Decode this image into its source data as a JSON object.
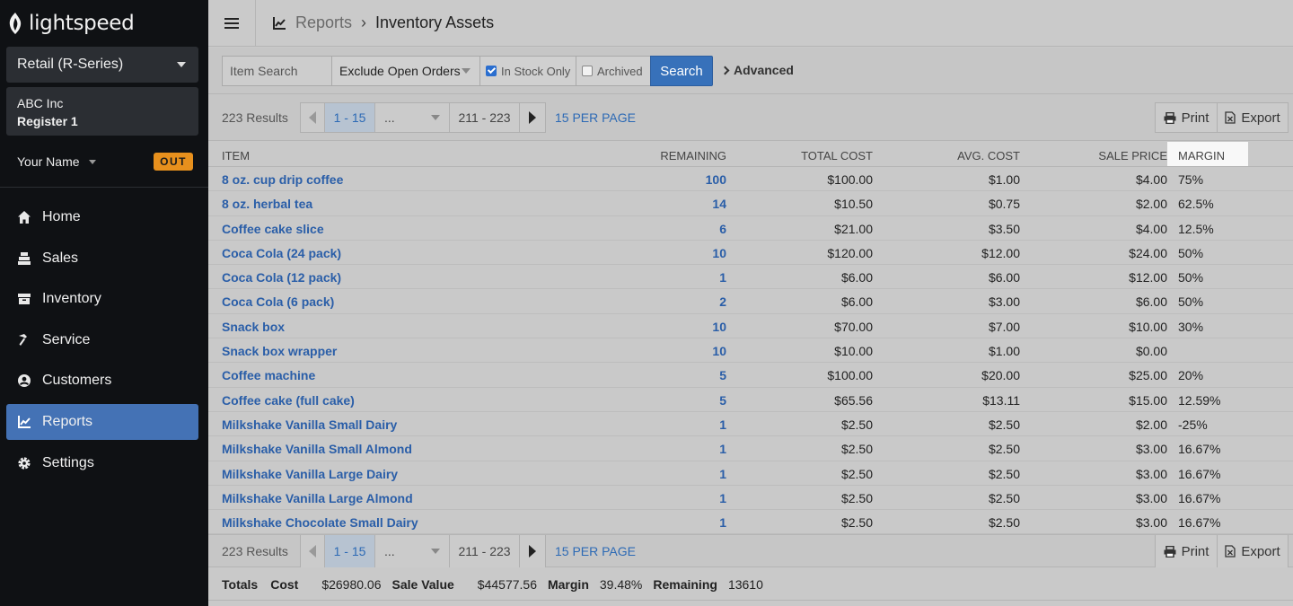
{
  "brand": {
    "name": "lightspeed"
  },
  "sidebar": {
    "product": "Retail (R-Series)",
    "shop": {
      "company": "ABC Inc",
      "register": "Register 1"
    },
    "user": {
      "name": "Your Name",
      "status": "OUT"
    },
    "nav": [
      {
        "label": "Home",
        "icon": "home-icon"
      },
      {
        "label": "Sales",
        "icon": "register-icon"
      },
      {
        "label": "Inventory",
        "icon": "box-icon"
      },
      {
        "label": "Service",
        "icon": "hammer-icon"
      },
      {
        "label": "Customers",
        "icon": "person-icon"
      },
      {
        "label": "Reports",
        "icon": "chart-icon",
        "active": true
      },
      {
        "label": "Settings",
        "icon": "gear-icon"
      }
    ]
  },
  "header": {
    "breadcrumb_parent": "Reports",
    "breadcrumb_current": "Inventory Assets"
  },
  "filters": {
    "item_search_placeholder": "Item Search",
    "order_filter": "Exclude Open Orders",
    "in_stock_label": "In Stock Only",
    "in_stock_checked": true,
    "archived_label": "Archived",
    "archived_checked": false,
    "search_label": "Search",
    "advanced_label": "Advanced"
  },
  "pagination": {
    "results": "223 Results",
    "current": "1 - 15",
    "dots": "...",
    "last": "211 - 223",
    "per_page": "15 PER PAGE",
    "print_label": "Print",
    "export_label": "Export"
  },
  "table": {
    "columns": [
      "ITEM",
      "REMAINING",
      "TOTAL COST",
      "AVG. COST",
      "SALE PRICE",
      "MARGIN"
    ],
    "rows": [
      [
        "8 oz. cup drip coffee",
        "100",
        "$100.00",
        "$1.00",
        "$4.00",
        "75%"
      ],
      [
        "8 oz. herbal tea",
        "14",
        "$10.50",
        "$0.75",
        "$2.00",
        "62.5%"
      ],
      [
        "Coffee cake slice",
        "6",
        "$21.00",
        "$3.50",
        "$4.00",
        "12.5%"
      ],
      [
        "Coca Cola (24 pack)",
        "10",
        "$120.00",
        "$12.00",
        "$24.00",
        "50%"
      ],
      [
        "Coca Cola (12 pack)",
        "1",
        "$6.00",
        "$6.00",
        "$12.00",
        "50%"
      ],
      [
        "Coca Cola (6 pack)",
        "2",
        "$6.00",
        "$3.00",
        "$6.00",
        "50%"
      ],
      [
        "Snack box",
        "10",
        "$70.00",
        "$7.00",
        "$10.00",
        "30%"
      ],
      [
        "Snack box wrapper",
        "10",
        "$10.00",
        "$1.00",
        "$0.00",
        ""
      ],
      [
        "Coffee machine",
        "5",
        "$100.00",
        "$20.00",
        "$25.00",
        "20%"
      ],
      [
        "Coffee cake (full cake)",
        "5",
        "$65.56",
        "$13.11",
        "$15.00",
        "12.59%"
      ],
      [
        "Milkshake Vanilla Small Dairy",
        "1",
        "$2.50",
        "$2.50",
        "$2.00",
        "-25%"
      ],
      [
        "Milkshake Vanilla Small Almond",
        "1",
        "$2.50",
        "$2.50",
        "$3.00",
        "16.67%"
      ],
      [
        "Milkshake Vanilla Large Dairy",
        "1",
        "$2.50",
        "$2.50",
        "$3.00",
        "16.67%"
      ],
      [
        "Milkshake Vanilla Large Almond",
        "1",
        "$2.50",
        "$2.50",
        "$3.00",
        "16.67%"
      ],
      [
        "Milkshake Chocolate Small Dairy",
        "1",
        "$2.50",
        "$2.50",
        "$3.00",
        "16.67%"
      ]
    ]
  },
  "totals": {
    "label": "Totals",
    "cost_label": "Cost",
    "cost": "$26980.06",
    "sale_label": "Sale Value",
    "sale": "$44577.56",
    "margin_label": "Margin",
    "margin": "39.48%",
    "remaining_label": "Remaining",
    "remaining": "13610"
  }
}
